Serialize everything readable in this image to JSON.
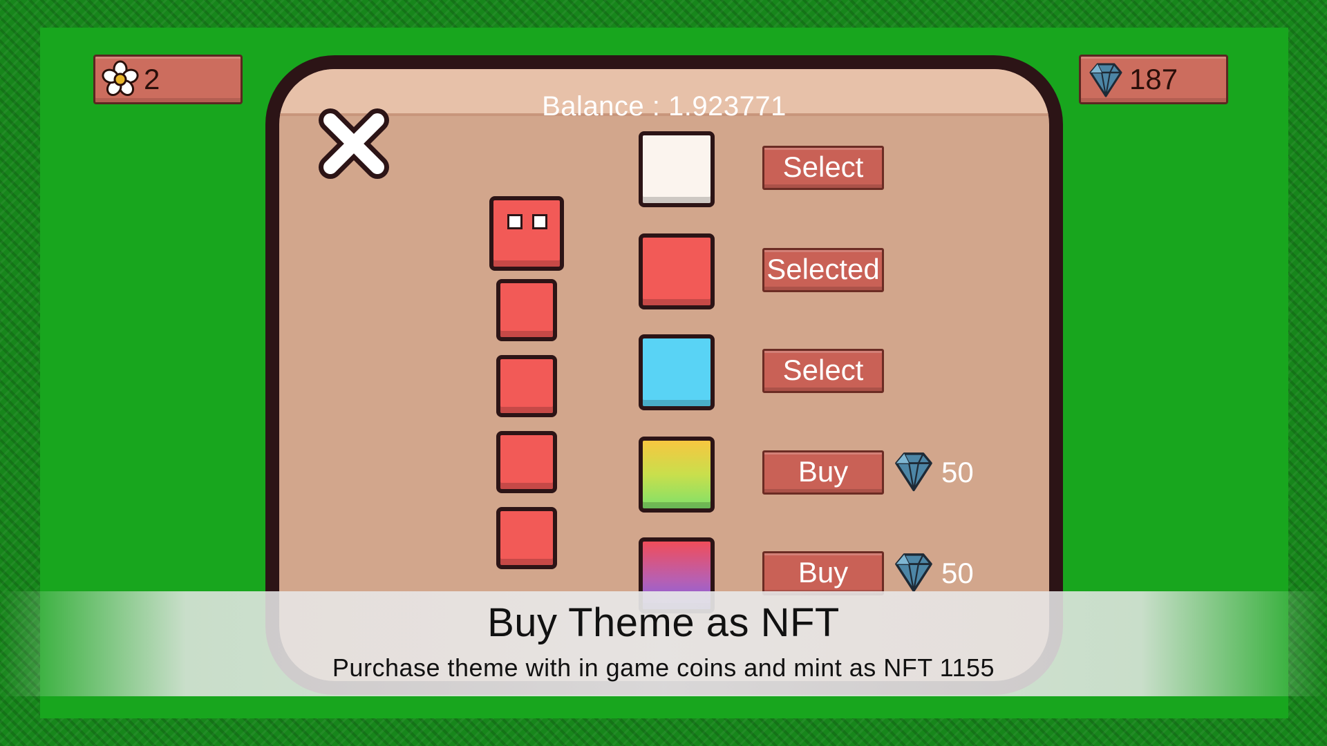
{
  "hud": {
    "flowers": {
      "icon": "flower-icon",
      "count": "2"
    },
    "gems": {
      "icon": "gem-icon",
      "count": "187"
    }
  },
  "panel": {
    "balance_text": "Balance : 1.923771",
    "close_icon": "close-icon"
  },
  "themes": [
    {
      "swatch": "white",
      "button": "Select"
    },
    {
      "swatch": "red",
      "button": "Selected"
    },
    {
      "swatch": "cyan",
      "button": "Select"
    },
    {
      "swatch": "yellow-green-gradient",
      "button": "Buy",
      "price_icon": "gem-icon",
      "price": "50"
    },
    {
      "swatch": "red-purple-gradient",
      "button": "Buy",
      "price_icon": "gem-icon",
      "price": "50"
    }
  ],
  "colors": {
    "player": "#f25a57",
    "theme_white": "#fbf4ee",
    "theme_red": "#f25a57",
    "theme_cyan": "#59d3f5",
    "button": "#c96156",
    "panel": "#d2a68c",
    "grass": "#18a61e"
  },
  "caption": {
    "title": "Buy Theme as NFT",
    "subtitle": "Purchase theme with in game coins and mint as NFT 1155"
  }
}
